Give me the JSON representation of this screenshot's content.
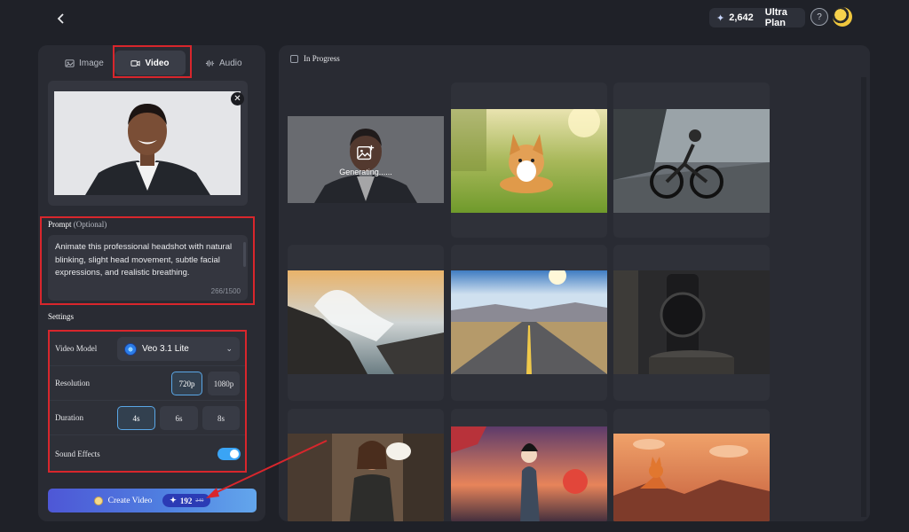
{
  "topbar": {
    "credits": "2,642",
    "plan": "Ultra Plan",
    "help": "?"
  },
  "tabs": [
    {
      "label": "Image",
      "icon": "image-icon"
    },
    {
      "label": "Video",
      "icon": "video-icon",
      "active": true
    },
    {
      "label": "Audio",
      "icon": "audio-icon"
    }
  ],
  "prompt": {
    "label": "Prompt",
    "optional": "(Optional)",
    "text": "Animate this professional headshot with natural blinking, slight head movement, subtle facial expressions, and realistic breathing.",
    "count": "266/1500"
  },
  "settings": {
    "label": "Settings",
    "video_model_label": "Video Model",
    "video_model_value": "Veo 3.1 Lite",
    "resolution_label": "Resolution",
    "resolution_options": [
      "720p",
      "1080p"
    ],
    "resolution_selected": "720p",
    "duration_label": "Duration",
    "duration_options": [
      "4s",
      "6s",
      "8s"
    ],
    "duration_selected": "4s",
    "sound_effects_label": "Sound Effects",
    "sound_effects_on": true
  },
  "create": {
    "label": "Create Video",
    "cost": "192",
    "old_cost": "240"
  },
  "gallery": {
    "filter_label": "In Progress",
    "generating_text": "Generating......",
    "items": [
      "generating-headshot",
      "corgi-meadow",
      "cyclist-rain",
      "coastal-waves",
      "desert-road",
      "wristwatch",
      "barista-cafe",
      "samurai-sunset",
      "fox-rooftops"
    ]
  },
  "colors": {
    "accent": "#3aa4f5",
    "annotation_red": "#d8262c",
    "panel": "#292b33",
    "background": "#1f2128"
  }
}
